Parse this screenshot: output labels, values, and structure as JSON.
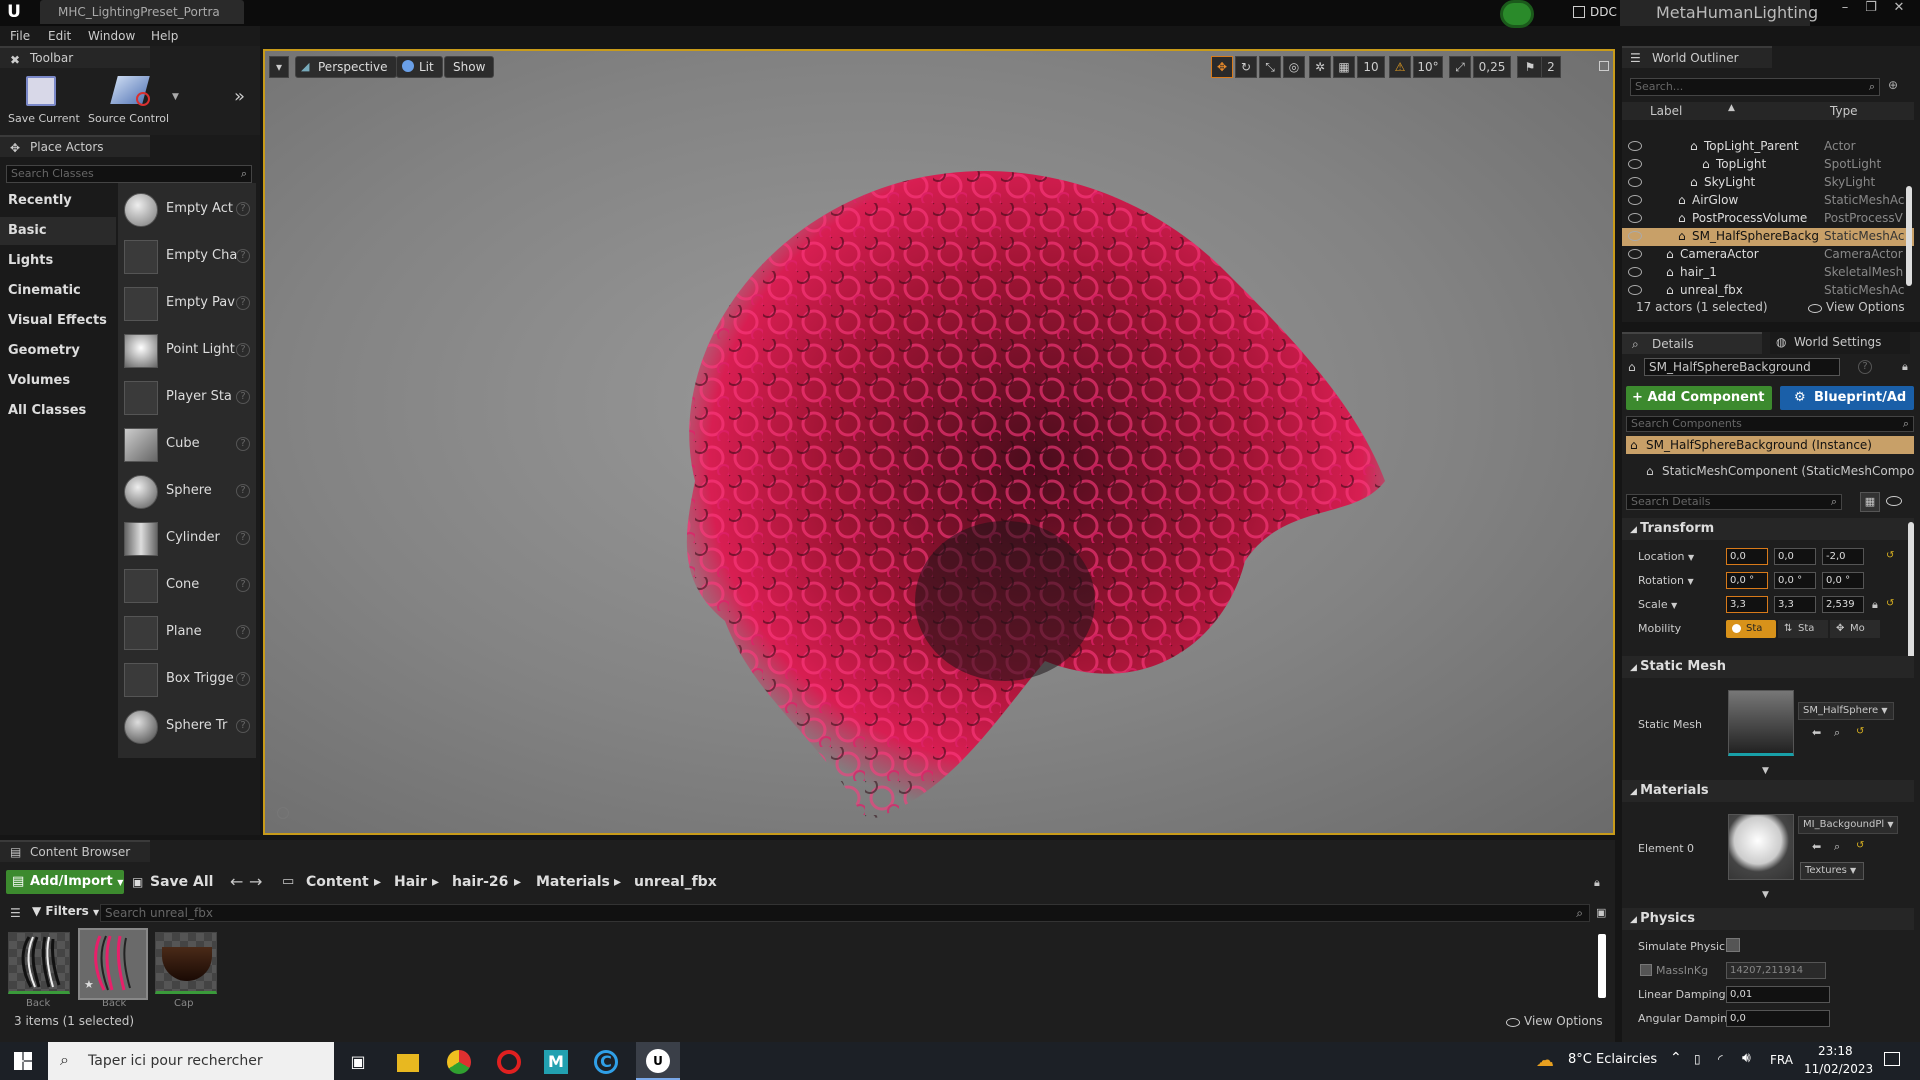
{
  "title_bar": {
    "doc_tab": "MHC_LightingPreset_Portra",
    "ddc_label": "DDC",
    "project_name": "MetaHumanLighting",
    "controls": [
      "–",
      "❐",
      "✕"
    ]
  },
  "menu": [
    "File",
    "Edit",
    "Window",
    "Help"
  ],
  "toolbar": {
    "tab_label": "Toolbar",
    "save_current": "Save Current",
    "source_control": "Source Control"
  },
  "place_actors": {
    "tab_label": "Place Actors",
    "search_placeholder": "Search Classes",
    "categories": [
      "Recently Placed",
      "Basic",
      "Lights",
      "Cinematic",
      "Visual Effects",
      "Geometry",
      "Volumes",
      "All Classes"
    ],
    "selected_category": "Basic",
    "actors": [
      "Empty Act",
      "Empty Cha",
      "Empty Pav",
      "Point Light",
      "Player Sta",
      "Cube",
      "Sphere",
      "Cylinder",
      "Cone",
      "Plane",
      "Box Trigge",
      "Sphere Tr"
    ]
  },
  "viewport": {
    "perspective": "Perspective",
    "lit": "Lit",
    "show": "Show",
    "grid_snap": "10",
    "rotation_snap": "10°",
    "scale_snap": "0,25",
    "camera_speed": "2"
  },
  "world_outliner": {
    "tab_label": "World Outliner",
    "search_placeholder": "Search...",
    "col_label": "Label",
    "col_type": "Type",
    "rows": [
      {
        "label": "TopLight_Parent",
        "type": "Actor",
        "indent": 3,
        "selected": false
      },
      {
        "label": "TopLight",
        "type": "SpotLight",
        "indent": 4,
        "selected": false
      },
      {
        "label": "SkyLight",
        "type": "SkyLight",
        "indent": 3,
        "selected": false
      },
      {
        "label": "AirGlow",
        "type": "StaticMeshAc",
        "indent": 2,
        "selected": false
      },
      {
        "label": "PostProcessVolume",
        "type": "PostProcessV",
        "indent": 2,
        "selected": false
      },
      {
        "label": "SM_HalfSphereBackg",
        "type": "StaticMeshAc",
        "indent": 2,
        "selected": true
      },
      {
        "label": "CameraActor",
        "type": "CameraActor",
        "indent": 1,
        "selected": false
      },
      {
        "label": "hair_1",
        "type": "SkeletalMesh",
        "indent": 1,
        "selected": false
      },
      {
        "label": "unreal_fbx",
        "type": "StaticMeshAc",
        "indent": 1,
        "selected": false
      }
    ],
    "status": "17 actors (1 selected)",
    "view_options": "View Options"
  },
  "details": {
    "tab_details": "Details",
    "tab_world_settings": "World Settings",
    "object_name": "SM_HalfSphereBackground",
    "add_component": "Add Component",
    "blueprint": "Blueprint/Ad",
    "search_components": "Search Components",
    "instance_label": "SM_HalfSphereBackground (Instance)",
    "component_label": "StaticMeshComponent (StaticMeshComponent",
    "search_details": "Search Details",
    "transform": {
      "section": "Transform",
      "location_label": "Location",
      "location": [
        "0,0",
        "0,0",
        "-2,0"
      ],
      "rotation_label": "Rotation",
      "rotation": [
        "0,0 °",
        "0,0 °",
        "0,0 °"
      ],
      "scale_label": "Scale",
      "scale": [
        "3,3",
        "3,3",
        "2,539"
      ],
      "mobility_label": "Mobility",
      "mobility": [
        "Sta",
        "Sta",
        "Mo"
      ]
    },
    "static_mesh": {
      "section": "Static Mesh",
      "label": "Static Mesh",
      "value": "SM_HalfSphere"
    },
    "materials": {
      "section": "Materials",
      "label": "Element 0",
      "value": "MI_BackgoundPl",
      "textures": "Textures"
    },
    "physics": {
      "section": "Physics",
      "simulate": "Simulate Physic",
      "mass_label": "MassInKg",
      "mass": "14207,211914",
      "linear_label": "Linear Damping",
      "linear": "0,01",
      "angular_label": "Angular Dampin",
      "angular": "0,0"
    }
  },
  "content_browser": {
    "tab_label": "Content Browser",
    "add_import": "Add/Import",
    "save_all": "Save All",
    "path": [
      "Content",
      "Hair",
      "hair-26",
      "Materials",
      "unreal_fbx"
    ],
    "filters": "Filters",
    "search_placeholder": "Search unreal_fbx",
    "assets": [
      "Back",
      "Back",
      "Cap"
    ],
    "status": "3 items (1 selected)",
    "view_options": "View Options"
  },
  "taskbar": {
    "search_placeholder": "Taper ici pour rechercher",
    "weather": "8°C  Eclaircies",
    "lang": "FRA",
    "time": "23:18",
    "date": "11/02/2023"
  },
  "colors": {
    "accent_orange": "#c89b1a",
    "green_button": "#3c8a2e",
    "blue_button": "#1a5fa8",
    "hair_red": "#b0123a"
  }
}
